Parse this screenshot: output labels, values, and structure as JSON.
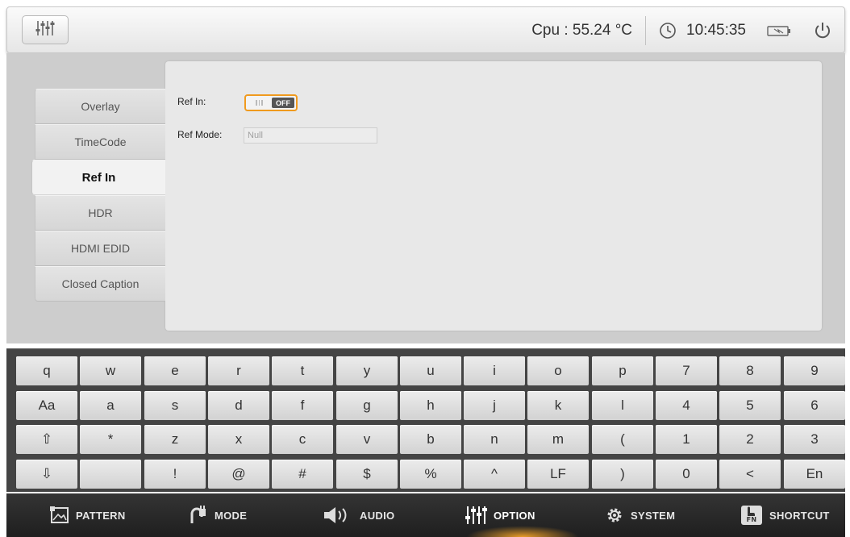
{
  "topbar": {
    "menu_icon": "sliders-icon",
    "cpu_label": "Cpu : 55.24 °C",
    "clock_icon": "clock-icon",
    "time": "10:45:35",
    "battery_icon": "battery-charging-icon",
    "power_icon": "power-icon"
  },
  "sidebar": {
    "items": [
      {
        "label": "Overlay",
        "active": false
      },
      {
        "label": "TimeCode",
        "active": false
      },
      {
        "label": "Ref In",
        "active": true
      },
      {
        "label": "HDR",
        "active": false
      },
      {
        "label": "HDMI EDID",
        "active": false
      },
      {
        "label": "Closed Caption",
        "active": false
      }
    ]
  },
  "form": {
    "ref_in_label": "Ref In:",
    "ref_in_state": "OFF",
    "ref_mode_label": "Ref Mode:",
    "ref_mode_value": "Null"
  },
  "keyboard": {
    "rows": [
      [
        "q",
        "w",
        "e",
        "r",
        "t",
        "y",
        "u",
        "i",
        "o",
        "p",
        "7",
        "8",
        "9"
      ],
      [
        "Aa",
        "a",
        "s",
        "d",
        "f",
        "g",
        "h",
        "j",
        "k",
        "l",
        "4",
        "5",
        "6"
      ],
      [
        "⇧",
        "*",
        "z",
        "x",
        "c",
        "v",
        "b",
        "n",
        "m",
        "(",
        "1",
        "2",
        "3"
      ],
      [
        "⇩",
        "",
        "!",
        "@",
        "#",
        "$",
        "%",
        "^",
        "LF",
        ")",
        "0",
        "<",
        "En"
      ]
    ]
  },
  "navbar": {
    "items": [
      {
        "label": "PATTERN",
        "icon": "image-icon",
        "active": false
      },
      {
        "label": "MODE",
        "icon": "plug-icon",
        "active": false
      },
      {
        "label": "AUDIO",
        "icon": "speaker-icon",
        "active": false
      },
      {
        "label": "OPTION",
        "icon": "sliders-icon",
        "active": true
      },
      {
        "label": "SYSTEM",
        "icon": "gear-icon",
        "active": false
      },
      {
        "label": "SHORTCUT",
        "icon": "fn-hand-icon",
        "active": false
      }
    ]
  },
  "colors": {
    "accent": "#f09a1e",
    "keyboard_bg": "#444444",
    "workarea_bg": "#cdcdcd"
  }
}
